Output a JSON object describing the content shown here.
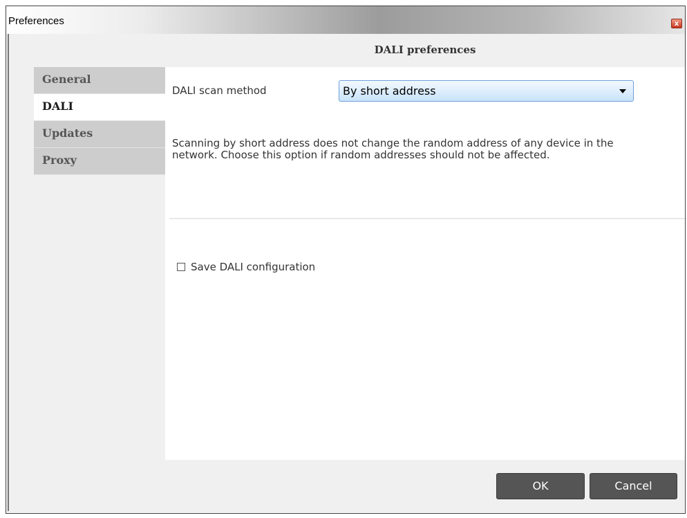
{
  "window": {
    "title": "Preferences",
    "close_glyph": "x"
  },
  "pane_title": "DALI preferences",
  "nav": {
    "items": [
      {
        "label": "General",
        "active": false
      },
      {
        "label": "DALI",
        "active": true
      },
      {
        "label": "Updates",
        "active": false
      },
      {
        "label": "Proxy",
        "active": false
      }
    ]
  },
  "dali": {
    "scan_method_label": "DALI scan method",
    "scan_method_value": "By short address",
    "description": "Scanning by short address does not change the random address of any device in the network. Choose this option if random addresses should not be affected.",
    "save_config_label": "Save DALI configuration",
    "save_config_checked": false
  },
  "buttons": {
    "ok": "OK",
    "cancel": "Cancel"
  },
  "icons": {
    "close": "close-icon",
    "dropdown": "chevron-down-icon",
    "checkbox": "checkbox-icon"
  },
  "colors": {
    "active_nav_bg": "#ffffff",
    "inactive_nav_bg": "#cdcdcd",
    "button_bg": "#555555",
    "select_border": "#6f9fd8",
    "close_red": "#c6371e"
  }
}
